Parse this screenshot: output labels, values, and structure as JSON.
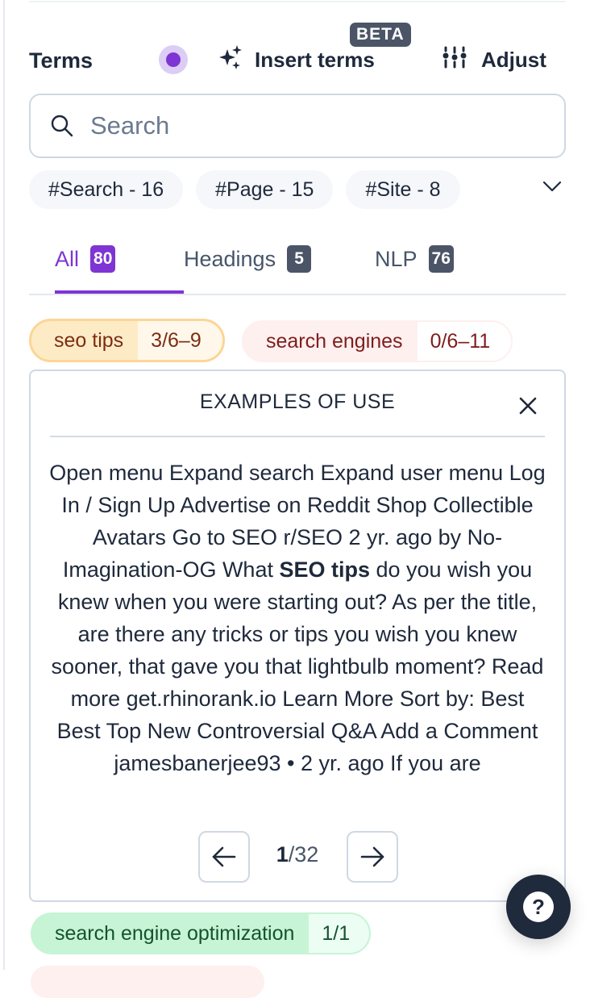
{
  "header": {
    "title": "Terms",
    "status_dot_color": "#7e35d3",
    "insert_terms_label": "Insert terms",
    "beta_badge": "BETA",
    "adjust_label": "Adjust"
  },
  "search": {
    "placeholder": "Search",
    "value": ""
  },
  "filter_chips": [
    {
      "label": "#Search - 16"
    },
    {
      "label": "#Page - 15"
    },
    {
      "label": "#Site - 8"
    }
  ],
  "tabs": [
    {
      "label": "All",
      "count": "80",
      "active": true
    },
    {
      "label": "Headings",
      "count": "5",
      "active": false
    },
    {
      "label": "NLP",
      "count": "76",
      "active": false
    }
  ],
  "terms": [
    {
      "name": "seo tips",
      "count": "3/6–9",
      "status": "selected"
    },
    {
      "name": "search engines",
      "count": "0/6–11",
      "status": "missing"
    },
    {
      "name": "search engine optimization",
      "count": "1/1",
      "status": "complete"
    }
  ],
  "examples_panel": {
    "title": "EXAMPLES OF USE",
    "text_before": "Open menu Expand search Expand user menu Log In / Sign Up Advertise on Reddit Shop Collectible Avatars Go to SEO r/SEO 2 yr. ago by No-Imagination-OG What ",
    "highlight": "SEO tips",
    "text_after": " do you wish you knew when you were starting out? As per the title, are there any tricks or tips you wish you knew sooner, that gave you that lightbulb moment? Read more get.rhinorank.io Learn More Sort by: Best Best Top New Controversial Q&A Add a Comment jamesbanerjee93 • 2 yr. ago If you are",
    "pager": {
      "current": "1",
      "total": "/32"
    }
  },
  "help_button": {
    "label": "?"
  },
  "colors": {
    "accent": "#7e35d3",
    "badge_gray": "#4b5567",
    "selected_term_bg": "#fdebc6",
    "missing_term_bg": "#fdf0ef",
    "complete_term_bg": "#c7f4d5"
  }
}
